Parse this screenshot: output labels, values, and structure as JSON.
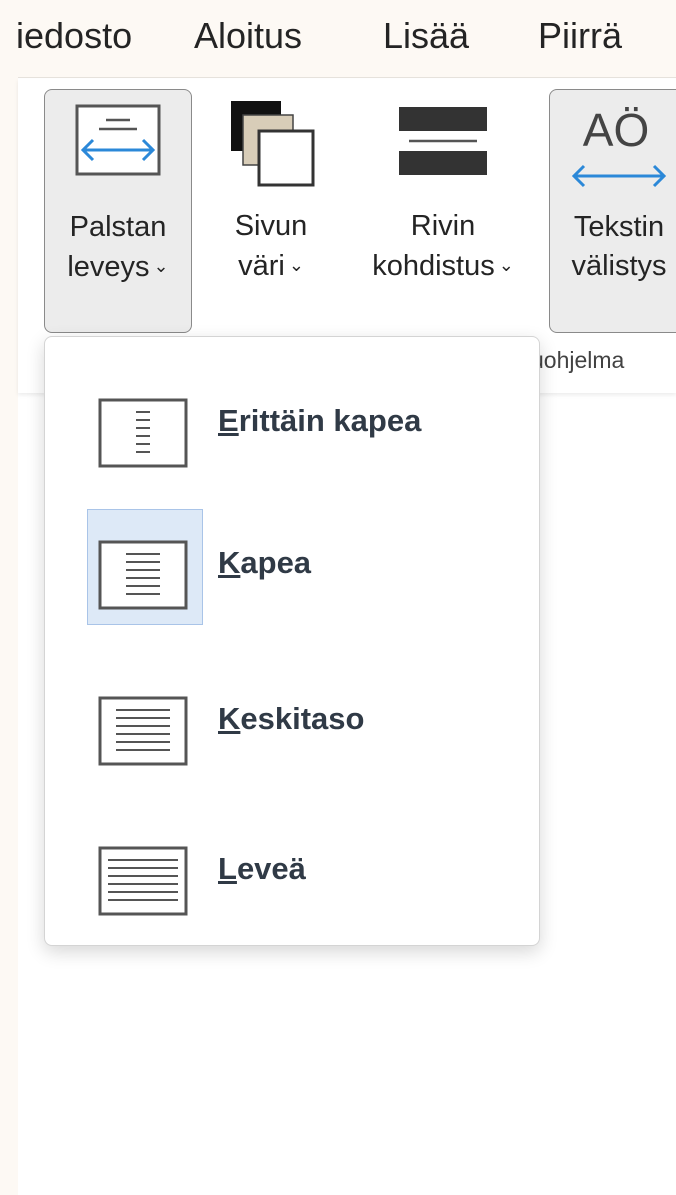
{
  "tabs": [
    "iedosto",
    "Aloitus",
    "Lisää",
    "Piirrä"
  ],
  "ribbon": {
    "buttons": [
      {
        "line1": "Palstan",
        "line2": "leveys",
        "chevron": "⌄",
        "icon": "column-width-icon"
      },
      {
        "line1": "Sivun",
        "line2": "väri",
        "chevron": "⌄",
        "icon": "page-color-icon"
      },
      {
        "line1": "Rivin",
        "line2": "kohdistus",
        "chevron": "⌄",
        "icon": "line-focus-icon"
      },
      {
        "line1": "Tekstin",
        "line2": "välistys",
        "icon": "text-spacing-icon",
        "icon_text": "AÖ"
      }
    ],
    "group_label": "uohjelma"
  },
  "menu": {
    "items": [
      {
        "access_key": "E",
        "rest": "rittäin kapea",
        "selected": false,
        "icon": "very-narrow-icon"
      },
      {
        "access_key": "K",
        "rest": "apea",
        "selected": true,
        "icon": "narrow-icon"
      },
      {
        "access_key": "K",
        "rest": "eskitaso",
        "selected": false,
        "icon": "moderate-icon"
      },
      {
        "access_key": "L",
        "rest": "eveä",
        "selected": false,
        "icon": "wide-icon"
      }
    ]
  },
  "colors": {
    "accent_blue": "#2b88d8",
    "selection_bg": "#dde9f7",
    "menu_text": "#303a46"
  }
}
